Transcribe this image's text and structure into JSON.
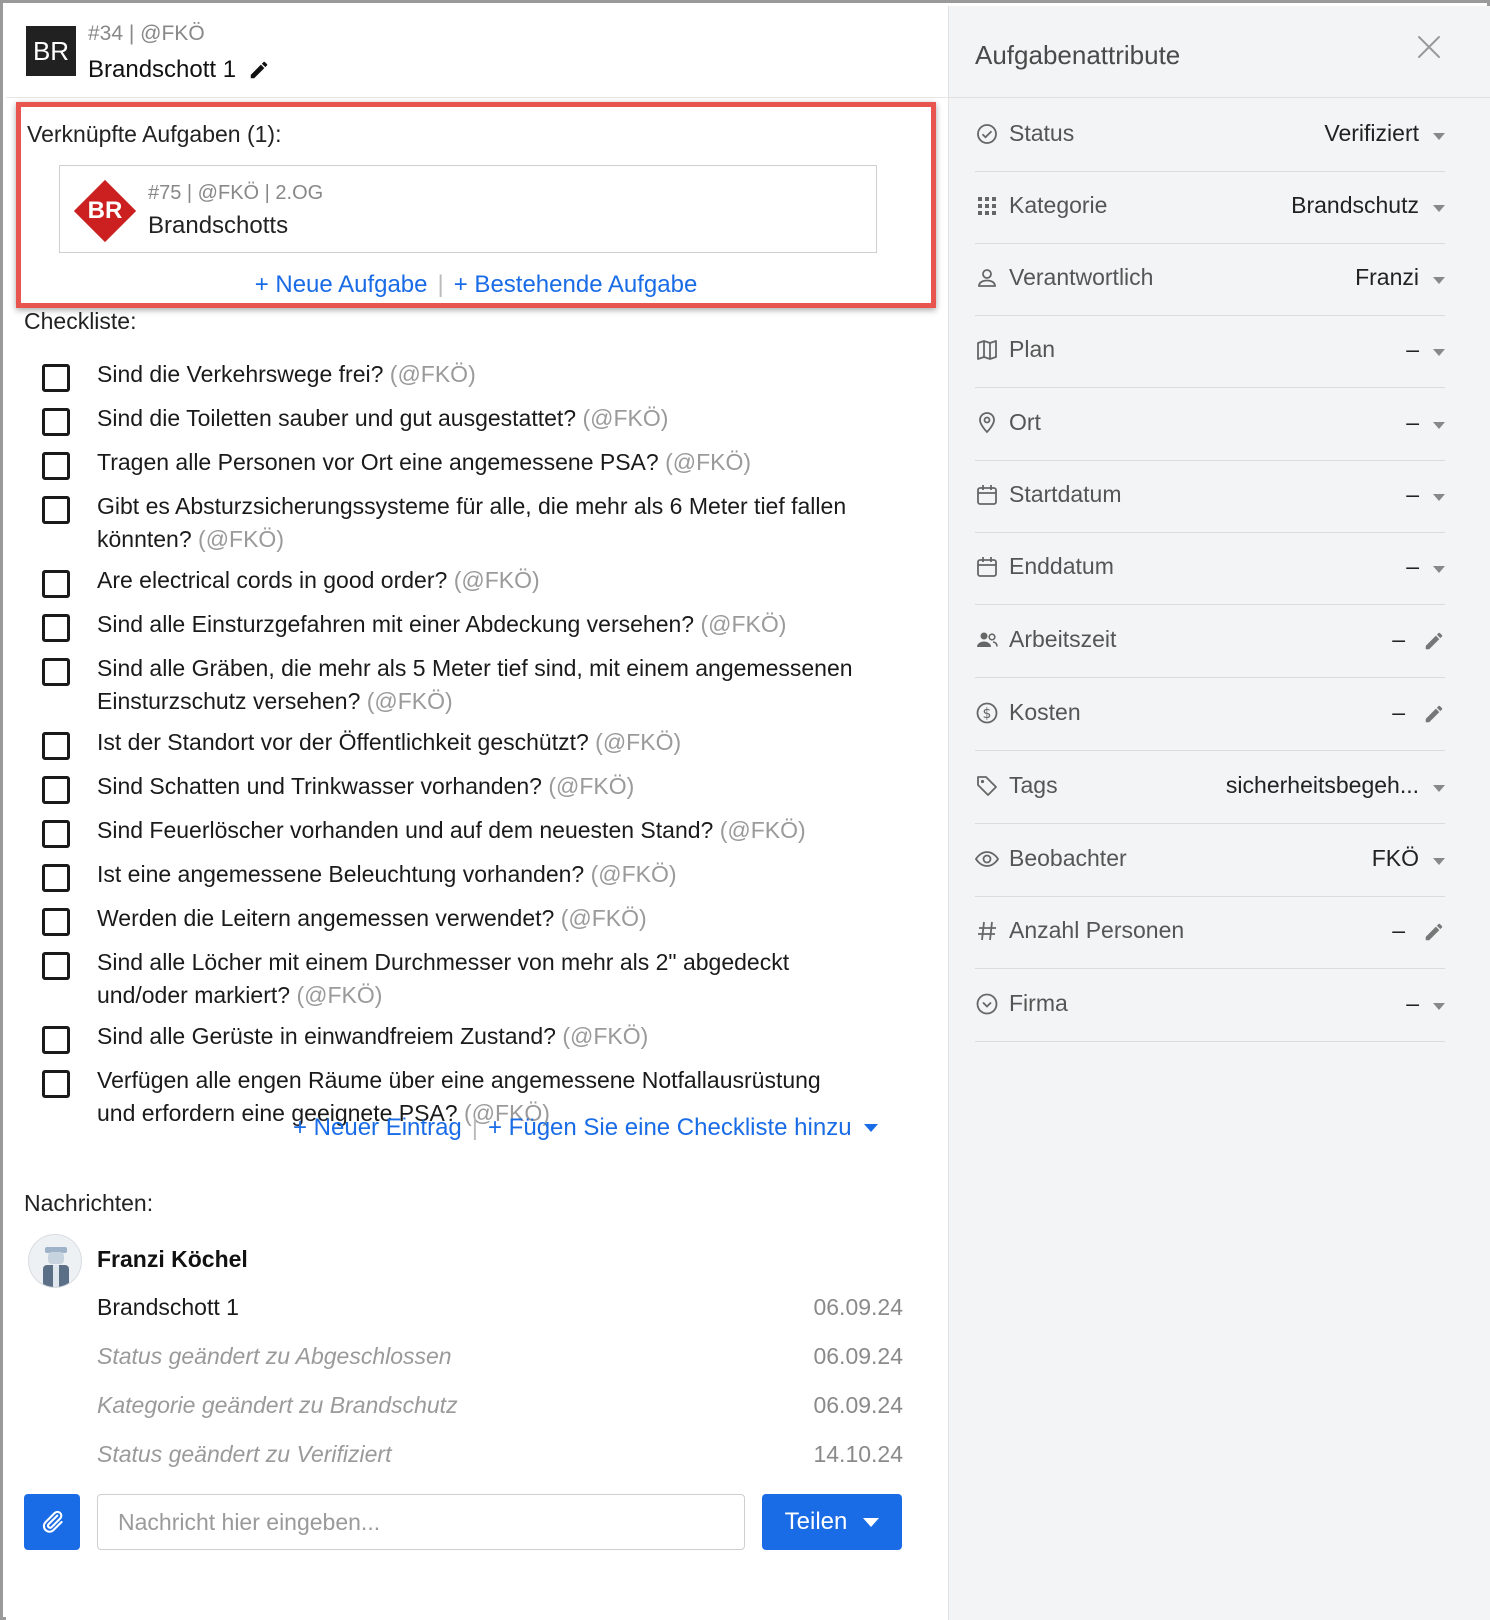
{
  "header": {
    "logo": "BR",
    "meta": "#34 | @FKÖ",
    "title": "Brandschott 1"
  },
  "linked": {
    "label": "Verknüpfte Aufgaben (1):",
    "task": {
      "badge": "BR",
      "badge_color": "#cc1f1f",
      "meta": "#75 | @FKÖ | 2.OG",
      "name": "Brandschotts"
    },
    "new_task": "+ Neue Aufgabe",
    "separator": "|",
    "existing_task": "+ Bestehende Aufgabe"
  },
  "checklist": {
    "label": "Checkliste:",
    "items": [
      {
        "text": "Sind die Verkehrswege frei?",
        "mention": "(@FKÖ)"
      },
      {
        "text": "Sind die Toiletten sauber und gut ausgestattet?",
        "mention": "(@FKÖ)"
      },
      {
        "text": "Tragen alle Personen vor Ort eine angemessene PSA?",
        "mention": "(@FKÖ)"
      },
      {
        "text": "Gibt es Absturzsicherungssysteme für alle, die mehr als 6 Meter tief fallen könnten?",
        "mention": "(@FKÖ)"
      },
      {
        "text": "Are electrical cords in good order?",
        "mention": "(@FKÖ)"
      },
      {
        "text": "Sind alle Einsturzgefahren mit einer Abdeckung versehen?",
        "mention": "(@FKÖ)"
      },
      {
        "text": "Sind alle Gräben, die mehr als 5 Meter tief sind, mit einem angemessenen Einsturzschutz versehen?",
        "mention": "(@FKÖ)"
      },
      {
        "text": "Ist der Standort vor der Öffentlichkeit geschützt?",
        "mention": "(@FKÖ)"
      },
      {
        "text": "Sind Schatten und Trinkwasser vorhanden?",
        "mention": "(@FKÖ)"
      },
      {
        "text": "Sind Feuerlöscher vorhanden und auf dem neuesten Stand?",
        "mention": "(@FKÖ)"
      },
      {
        "text": "Ist eine angemessene Beleuchtung vorhanden?",
        "mention": "(@FKÖ)"
      },
      {
        "text": "Werden die Leitern angemessen verwendet?",
        "mention": "(@FKÖ)"
      },
      {
        "text": "Sind alle Löcher mit einem Durchmesser von mehr als 2\" abgedeckt und/oder markiert?",
        "mention": "(@FKÖ)"
      },
      {
        "text": "Sind alle Gerüste in einwandfreiem Zustand?",
        "mention": "(@FKÖ)"
      },
      {
        "text": "Verfügen alle engen Räume über eine angemessene Notfallausrüstung und erfordern eine geeignete PSA?",
        "mention": "(@FKÖ)"
      }
    ],
    "new_entry": "+ Neuer Eintrag",
    "separator": "|",
    "add_checklist": "+ Fügen Sie eine Checkliste hinzu"
  },
  "messages": {
    "label": "Nachrichten:",
    "author": "Franzi Köchel",
    "entries": [
      {
        "text": "Brandschott 1",
        "date": "06.09.24",
        "system": false
      },
      {
        "text": "Status geändert zu Abgeschlossen",
        "date": "06.09.24",
        "system": true
      },
      {
        "text": "Kategorie geändert zu Brandschutz",
        "date": "06.09.24",
        "system": true
      },
      {
        "text": "Status geändert zu Verifiziert",
        "date": "14.10.24",
        "system": true
      }
    ]
  },
  "composer": {
    "placeholder": "Nachricht hier eingeben...",
    "share_label": "Teilen",
    "accent": "#1a6ce6"
  },
  "attributes": {
    "title": "Aufgabenattribute",
    "items": [
      {
        "label": "Status",
        "value": "Verifiziert",
        "icon": "check-circle-icon",
        "control": "dropdown"
      },
      {
        "label": "Kategorie",
        "value": "Brandschutz",
        "icon": "grid-icon",
        "control": "dropdown"
      },
      {
        "label": "Verantwortlich",
        "value": "Franzi",
        "icon": "user-icon",
        "control": "dropdown"
      },
      {
        "label": "Plan",
        "value": "–",
        "icon": "map-icon",
        "control": "dropdown"
      },
      {
        "label": "Ort",
        "value": "–",
        "icon": "location-pin-icon",
        "control": "dropdown"
      },
      {
        "label": "Startdatum",
        "value": "–",
        "icon": "calendar-icon",
        "control": "dropdown"
      },
      {
        "label": "Enddatum",
        "value": "–",
        "icon": "calendar-icon",
        "control": "dropdown"
      },
      {
        "label": "Arbeitszeit",
        "value": "–",
        "icon": "people-icon",
        "control": "edit"
      },
      {
        "label": "Kosten",
        "value": "–",
        "icon": "dollar-circle-icon",
        "control": "edit"
      },
      {
        "label": "Tags",
        "value": "sicherheitsbegeh...",
        "icon": "tag-icon",
        "control": "dropdown"
      },
      {
        "label": "Beobachter",
        "value": "FKÖ",
        "icon": "eye-icon",
        "control": "dropdown"
      },
      {
        "label": "Anzahl Personen",
        "value": "–",
        "icon": "hash-icon",
        "control": "edit"
      },
      {
        "label": "Firma",
        "value": "–",
        "icon": "chevron-circle-icon",
        "control": "dropdown"
      }
    ]
  }
}
